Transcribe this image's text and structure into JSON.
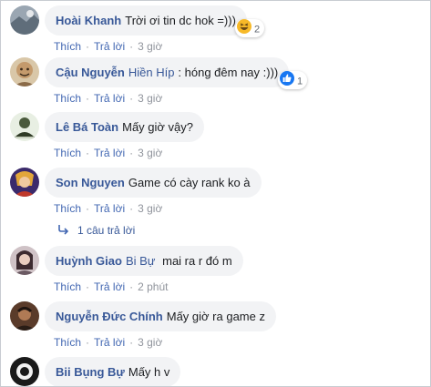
{
  "action_labels": {
    "like": "Thích",
    "reply": "Trả lời"
  },
  "comments": [
    {
      "author": "Hoài Khanh",
      "mention": "",
      "text": "Trời ơi tin dc hok =)))",
      "time": "3 giờ",
      "reaction": {
        "type": "haha",
        "count": "2"
      }
    },
    {
      "author": "Cậu Nguyễn",
      "mention": "Hiền Híp",
      "text": ": hóng đêm nay :)))",
      "time": "3 giờ",
      "reaction": {
        "type": "like",
        "count": "1"
      }
    },
    {
      "author": "Lê Bá Toàn",
      "mention": "",
      "text": "Mấy giờ vậy?",
      "time": "3 giờ"
    },
    {
      "author": "Son Nguyen",
      "mention": "",
      "text": "Game có cày rank ko à",
      "time": "3 giờ",
      "replies": "1 câu trả lời"
    },
    {
      "author": "Huỳnh Giao",
      "mention": "Bi Bự",
      "text": "mai ra r đó m",
      "time": "2 phút"
    },
    {
      "author": "Nguyễn Đức Chính",
      "mention": "",
      "text": "Mấy giờ ra game z",
      "time": "3 giờ"
    },
    {
      "author": "Bii Bụng Bự",
      "mention": "",
      "text": "Mấy h v",
      "time": ""
    }
  ],
  "colors": {
    "link": "#385898",
    "action_link": "#4267b2",
    "bubble": "#f2f3f5",
    "meta": "#90949c",
    "like_blue": "#1877f2",
    "haha_yellow": "#f7b928"
  },
  "icons": {
    "like": "thumbs-up-icon",
    "haha": "laughing-face-icon",
    "reply_arrow": "reply-arrow-icon"
  }
}
